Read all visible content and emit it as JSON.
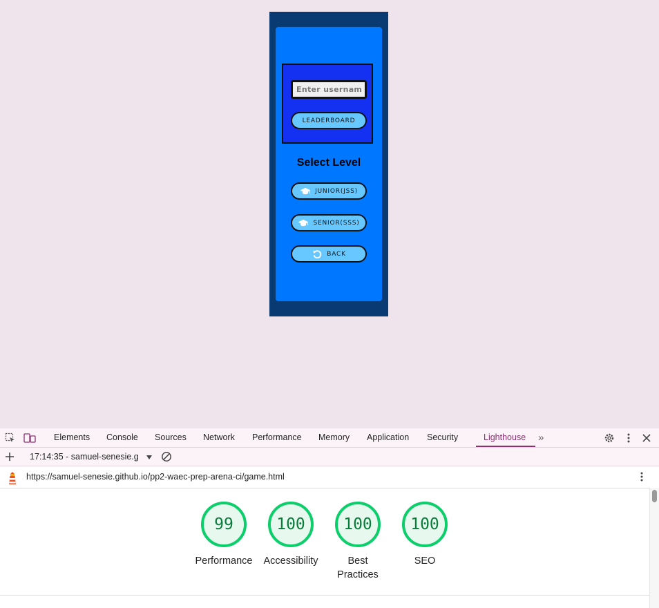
{
  "game": {
    "username_placeholder": "Enter username",
    "leaderboard_label": "LEADERBOARD",
    "select_level_title": "Select Level",
    "junior_label": "JUNIOR(JSS)",
    "senior_label": "SENIOR(SSS)",
    "back_label": "BACK",
    "junior_icon": "graduation-cap-icon",
    "senior_icon": "graduation-cap-icon",
    "back_icon": "undo-icon",
    "colors": {
      "page_bg": "#f0e4ec",
      "frame_bg": "#0a3a72",
      "card_bg": "#0077ff",
      "login_box_bg": "#1430f0",
      "button_bg": "#66c8ff"
    }
  },
  "devtools": {
    "tabs": [
      "Elements",
      "Console",
      "Sources",
      "Network",
      "Performance",
      "Memory",
      "Application",
      "Security",
      "Lighthouse"
    ],
    "active_tab": "Lighthouse",
    "more_tabs_glyph": "»",
    "report_selector": "17:14:35 - samuel-senesie.g",
    "report_url": "https://samuel-senesie.github.io/pp2-waec-prep-arena-ci/game.html",
    "accent_color": "#8a3270",
    "scores": [
      {
        "label": "Performance",
        "value": "99"
      },
      {
        "label": "Accessibility",
        "value": "100"
      },
      {
        "label": "Best Practices",
        "value": "100"
      },
      {
        "label": "SEO",
        "value": "100"
      }
    ],
    "score_color": "#0cce6b"
  }
}
